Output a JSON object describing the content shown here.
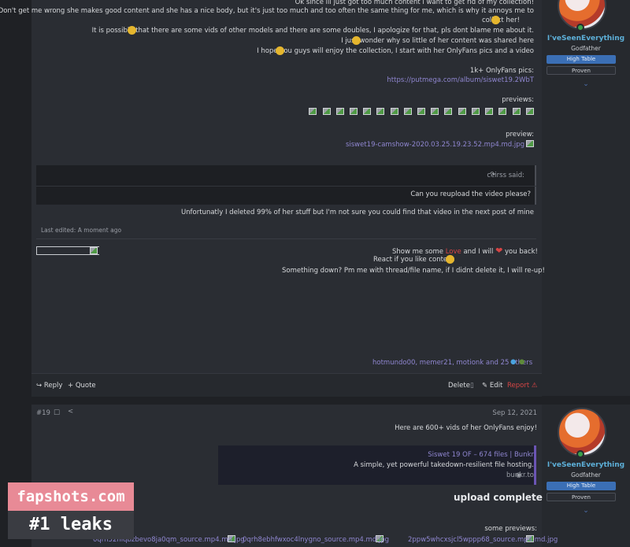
{
  "post1": {
    "lines": [
      "Ok since ill just got too much content i want to get rid of my collection!",
      "Don't get me wrong she makes good content and she has a nice body, but it's just too much and too often the same thing for me, which is why it annoys me to",
      "collect her!",
      "It is possible that there are some vids of other models and there are some doubles, I apologize for that, pls dont blame me about it.",
      "I just wonder why so little of her content was shared here",
      "I hope you guys will enjoy the collection, I start with her OnlyFans pics and a video"
    ],
    "pics_label": "1k+ OnlyFans pics:",
    "pics_link": "https://putmega.com/album/siswet19.2WbT",
    "previews_label": "previews:",
    "preview_label": "preview:",
    "preview_file": "siswet19-camshow-2020.03.25.19.23.52.mp4.md.jpg",
    "quote_author": "ceirss said:",
    "quote_icon": "arrow-up-icon",
    "quote_text": "Can you reupload the video please?",
    "reply_text": "Unfortunatly I deleted 99% of her stuff but I'm not sure you could find that video in the next post of mine",
    "last_edited": "Last edited: A moment ago",
    "sig_line1_a": "Show me some ",
    "sig_love": "Love",
    "sig_line1_b": " and I will ",
    "sig_line1_c": " you back!",
    "sig_line2": "React if you like content",
    "sig_line3": "Something down? Pm me with thread/file name, if I didnt delete it, I will re-up!",
    "reactions": "hotmundo00, memer21, motionk and 25 others",
    "actions": {
      "report": "Report",
      "edit": "Edit",
      "delete": "Delete",
      "quote": "+ Quote",
      "reply": "Reply"
    }
  },
  "user": {
    "name": "I'veSeenEverything",
    "title": "Godfather",
    "badge1": "High Table",
    "badge2": "Proven"
  },
  "post2": {
    "date": "Sep 12, 2021",
    "number": "#19",
    "intro": "Here are 600+ vids of her OnlyFans enjoy!",
    "embed_title": "Siswet 19 OF – 674 files | Bunkr",
    "embed_desc": "A simple, yet powerful takedown-resilient file hosting.",
    "embed_site": "bunkr.to",
    "heading": "upload complete",
    "some_previews": "some previews:",
    "files": [
      "2ppw5whcxsjcl5wppp68_source.mp4.md.jpg",
      "0qrh8ebhfwxoc4lnygno_source.mp4.md.jpg",
      "0qrh52hlqbzbevo8ja0qm_source.mp4.md.jpg"
    ]
  },
  "watermark": {
    "line1": "fapshots.com",
    "line2": "#1 leaks"
  },
  "colors": {
    "link": "#8f86d0",
    "username": "#5db0d9",
    "badge_blue": "#3b6fb5",
    "watermark_pink": "#e88a96"
  }
}
